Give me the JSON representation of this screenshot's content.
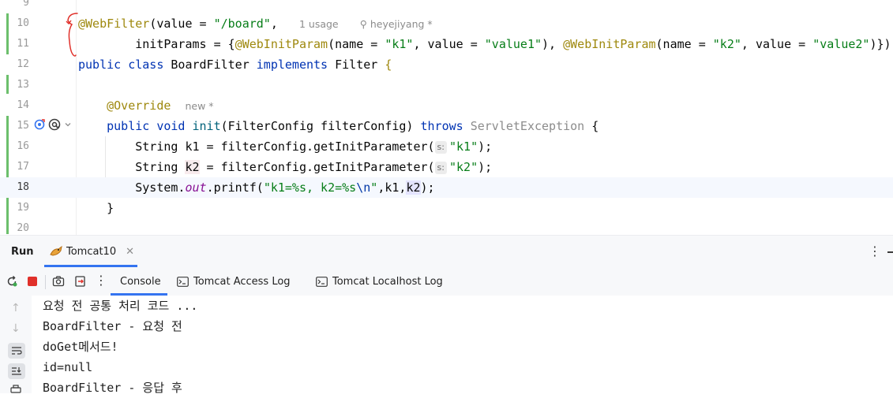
{
  "editor": {
    "lines": [
      {
        "num": "9"
      },
      {
        "num": "10",
        "hint_usage": "1 usage",
        "hint_author": "heyejiyang *"
      },
      {
        "num": "11"
      },
      {
        "num": "12"
      },
      {
        "num": "13"
      },
      {
        "num": "14",
        "hint_new": "new *"
      },
      {
        "num": "15"
      },
      {
        "num": "16",
        "param_hint": "s:"
      },
      {
        "num": "17",
        "param_hint": "s:"
      },
      {
        "num": "18"
      },
      {
        "num": "19"
      },
      {
        "num": "20"
      }
    ],
    "code": {
      "l10_ann": "@WebFilter",
      "l10_a": "(value = ",
      "l10_str": "\"/board\"",
      "l10_b": ",",
      "l11_a": "        initParams = {",
      "l11_ann1": "@WebInitParam",
      "l11_b": "(name = ",
      "l11_s1": "\"k1\"",
      "l11_c": ", value = ",
      "l11_s2": "\"value1\"",
      "l11_d": "), ",
      "l11_ann2": "@WebInitParam",
      "l11_e": "(name = ",
      "l11_s3": "\"k2\"",
      "l11_f": ", value = ",
      "l11_s4": "\"value2\"",
      "l11_g": ")})",
      "l12_kw1": "public class",
      "l12_a": " BoardFilter ",
      "l12_kw2": "implements",
      "l12_b": " Filter ",
      "l12_brace": "{",
      "l14_ann": "@Override",
      "l15_kw1": "public void",
      "l15_fn": " init",
      "l15_a": "(FilterConfig filterConfig) ",
      "l15_kw2": "throws",
      "l15_gray": " ServletException",
      "l15_b": " {",
      "l16_a": "String k1 = filterConfig.getInitParameter(",
      "l16_str": "\"k1\"",
      "l16_b": ");",
      "l17_a": "String ",
      "l17_var": "k2",
      "l17_b": " = filterConfig.getInitParameter(",
      "l17_str": "\"k2\"",
      "l17_c": ");",
      "l18_a": "System.",
      "l18_out": "out",
      "l18_b": ".printf(",
      "l18_str1": "\"k1=%s, k2=%s",
      "l18_esc": "\\n",
      "l18_str2": "\"",
      "l18_c": ",k1,",
      "l18_var": "k2",
      "l18_d": ");",
      "l19": "}"
    }
  },
  "run_panel": {
    "label": "Run",
    "tab": "Tomcat10",
    "tabs": [
      "Console",
      "Tomcat Access Log",
      "Tomcat Localhost Log"
    ],
    "console_lines": [
      "요청 전 공통 처리 코드 ...",
      "BoardFilter - 요청 전",
      "doGet메서드!",
      "id=null",
      "BoardFilter - 응답 후"
    ]
  },
  "colors": {
    "accent": "#3574f0",
    "annotation": "#9e880d",
    "keyword": "#0033b3",
    "string": "#067d17",
    "change_marker": "#6cbf6c",
    "red_markup": "#e0302a"
  }
}
